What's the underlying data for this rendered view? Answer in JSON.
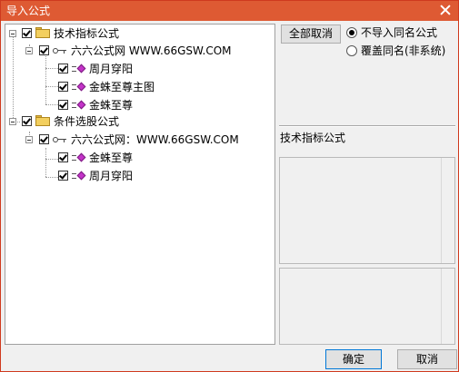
{
  "window": {
    "title": "导入公式"
  },
  "tree": [
    {
      "label": "技术指标公式",
      "type": "folder"
    },
    {
      "label": "六六公式网 WWW.66GSW.COM",
      "type": "key"
    },
    {
      "label": "周月穿阳",
      "type": "formula"
    },
    {
      "label": "金蛛至尊主图",
      "type": "formula"
    },
    {
      "label": "金蛛至尊",
      "type": "formula"
    },
    {
      "label": "条件选股公式",
      "type": "folder"
    },
    {
      "label": "六六公式网：WWW.66GSW.COM",
      "type": "key"
    },
    {
      "label": "金蛛至尊",
      "type": "formula"
    },
    {
      "label": "周月穿阳",
      "type": "formula"
    }
  ],
  "options": {
    "deselect_all": "全部取消",
    "no_import_same": "不导入同名公式",
    "overwrite_same": "覆盖同名(非系统)"
  },
  "detail": {
    "section_title": "技术指标公式"
  },
  "footer": {
    "ok": "确定",
    "cancel": "取消"
  },
  "colors": {
    "titlebar": "#de5a33",
    "formula_icon": "#c433c9",
    "folder_icon": "#f3cf5e"
  }
}
